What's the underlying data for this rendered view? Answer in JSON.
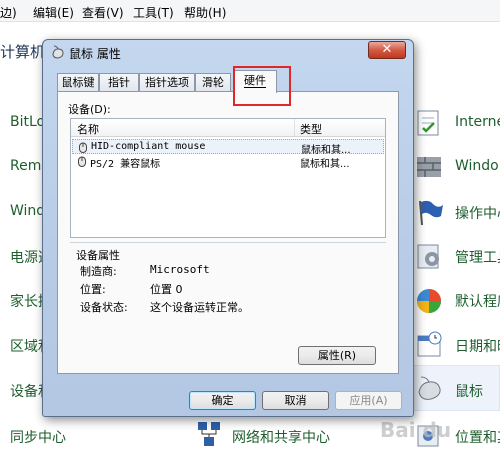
{
  "menubar": {
    "items": [
      "边)",
      "编辑(E)",
      "查看(V)",
      "工具(T)",
      "帮助(H)"
    ]
  },
  "background": {
    "title": "计算机",
    "left_items": [
      "BitLo",
      "Remo",
      "Wind",
      "电源选",
      "家长控",
      "区域和",
      "设备和",
      "同步中心"
    ],
    "right_items": [
      "Interne",
      "Windo",
      "操作中心",
      "管理工具",
      "默认程序",
      "日期和时",
      "鼠标",
      "位置和其"
    ],
    "network_label": "网络和共享中心"
  },
  "dialog": {
    "title": "鼠标 属性",
    "close_glyph": "✕",
    "tabs": [
      "鼠标键",
      "指针",
      "指针选项",
      "滑轮",
      "硬件"
    ],
    "active_tab": "硬件",
    "devices_label": "设备(D):",
    "columns": {
      "name": "名称",
      "type": "类型"
    },
    "devices": [
      {
        "name": "HID-compliant mouse",
        "type": "鼠标和其..."
      },
      {
        "name": "PS/2 兼容鼠标",
        "type": "鼠标和其..."
      }
    ],
    "properties": {
      "title": "设备属性",
      "manufacturer_label": "制造商:",
      "manufacturer_value": "Microsoft",
      "location_label": "位置:",
      "location_value": "位置 0",
      "status_label": "设备状态:",
      "status_value": "这个设备运转正常。"
    },
    "properties_button": "属性(R)",
    "ok_button": "确定",
    "cancel_button": "取消",
    "apply_button": "应用(A)"
  },
  "watermark": "Bai du"
}
